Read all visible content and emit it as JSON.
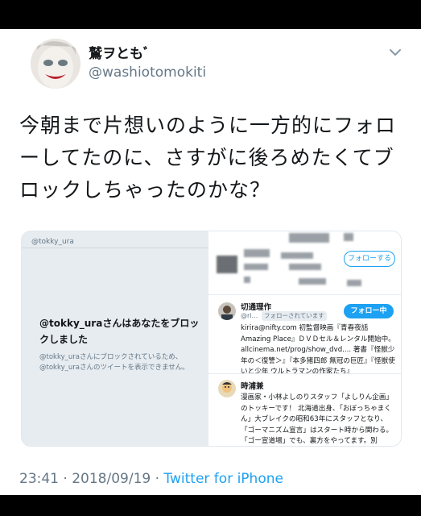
{
  "author": {
    "display_name": "鷲ヲともﾞ",
    "handle": "@washiotomokiti"
  },
  "tweet": {
    "text": "今朝まで片想いのように一方的にフォローしてたのに、さすがに後ろめたくてブロックしちゃったのかな？"
  },
  "embed": {
    "left_header": "@tokky_ura",
    "blocked_title": "@tokky_uraさんはあなたをブロックしました",
    "blocked_sub": "@tokky_uraさんにブロックされているため、@tokky_uraさんのツイートを表示できません。",
    "follow_label": "フォローする",
    "following_label": "フォロー中",
    "follows_you_label": "フォローされています",
    "user1": {
      "name": "切通理作",
      "handle": "@ri...",
      "bio": "kirira@nifty.com 初監督映画『青春夜話Amazing Place』ＤＶＤセル＆レンタル開始中。allcinema.net/prog/show_dvd.... 著書『怪獣少年の＜復讐＞』『本多猪四郎 無冠の巨匠』『怪獣使いと少年 ウルトラマンの作家たち』"
    },
    "user2": {
      "name": "時浦兼",
      "bio": "漫画家・小林よしのりスタッフ「よしりん企画」のトッキーです！ 北海道出身、「おぼっちゃまくん」大ブレイクの昭和63年にスタッフとなり、「ゴーマニズム宣言」はスタート時から関わる。「ゴー宣道場」でも、裏方をやってます。別"
    }
  },
  "meta": {
    "time": "23:41",
    "date": "2018/09/19",
    "via": "Twitter for iPhone"
  }
}
